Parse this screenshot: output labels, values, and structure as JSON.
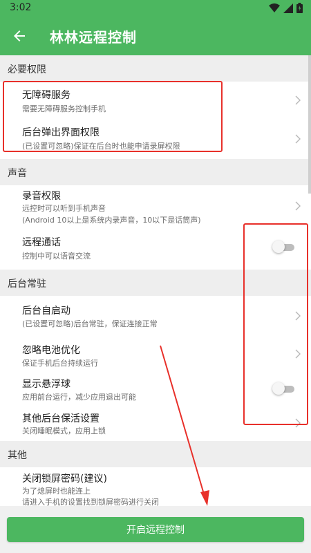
{
  "status_bar": {
    "time": "3:02"
  },
  "app_bar": {
    "title": "林林远程控制",
    "back_icon": "arrow-left-icon"
  },
  "sections": [
    {
      "header": "必要权限",
      "items": [
        {
          "title": "无障碍服务",
          "subtitle": "需要无障碍服务控制手机",
          "control": "chevron"
        },
        {
          "title": "后台弹出界面权限",
          "subtitle": "(已设置可忽略)保证在后台时也能申请录屏权限",
          "control": "chevron"
        }
      ]
    },
    {
      "header": "声音",
      "items": [
        {
          "title": "录音权限",
          "subtitle": "远控时可以听到手机声音",
          "subtitle2": "(Android 10以上是系统内录声音，10以下是话筒声)",
          "control": "chevron"
        },
        {
          "title": "远程通话",
          "subtitle": "控制中可以语音交流",
          "control": "toggle",
          "checked": false
        }
      ]
    },
    {
      "header": "后台常驻",
      "items": [
        {
          "title": "后台自启动",
          "subtitle": "(已设置可忽略)后台常驻，保证连接正常",
          "control": "chevron"
        },
        {
          "title": "忽略电池优化",
          "subtitle": "保证手机后台持续运行",
          "control": "chevron"
        },
        {
          "title": "显示悬浮球",
          "subtitle": "应用前台运行，减少应用退出可能",
          "control": "toggle",
          "checked": false
        },
        {
          "title": "其他后台保活设置",
          "subtitle": "关闭睡眠模式，应用上锁",
          "control": "chevron"
        }
      ]
    },
    {
      "header": "其他",
      "items": [
        {
          "title": "关闭锁屏密码(建议)",
          "subtitle": "为了熄屏时也能连上",
          "subtitle2": "请进入手机的设置找到锁屏密码进行关闭",
          "control": "none"
        }
      ]
    }
  ],
  "bottom_button": "开启远程控制",
  "colors": {
    "primary": "#4cb760",
    "annotation": "#e8302a"
  }
}
